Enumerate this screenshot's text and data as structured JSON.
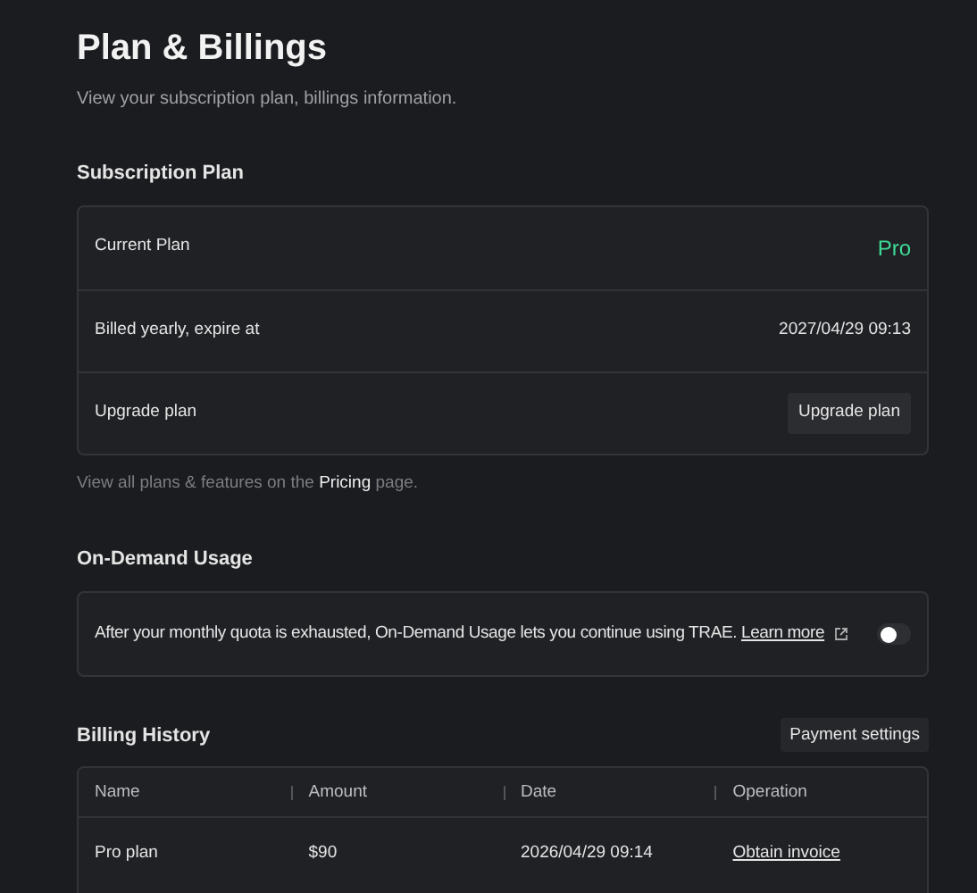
{
  "header": {
    "title": "Plan & Billings",
    "subtitle": "View your subscription plan, billings information."
  },
  "subscription": {
    "heading": "Subscription Plan",
    "rows": [
      {
        "kind": "plan",
        "label": "Current Plan",
        "value": "Pro"
      },
      {
        "kind": "text",
        "label": "Billed yearly, expire at",
        "value": "2027/04/29 09:13"
      },
      {
        "kind": "button",
        "label": "Upgrade plan",
        "value": "Upgrade plan"
      }
    ],
    "note": {
      "before": "View all plans & features on the",
      "link": "Pricing",
      "after": "page."
    }
  },
  "on_demand": {
    "heading": "On-Demand Usage",
    "text": "After your monthly quota is exhausted, On-Demand Usage lets you continue using TRAE.",
    "link": "Learn more",
    "toggle": {
      "on": false
    }
  },
  "billing": {
    "heading": "Billing History",
    "button": "Payment settings",
    "columns": [
      "Name",
      "Amount",
      "Date",
      "Operation"
    ],
    "rows": [
      {
        "cells": [
          "Pro plan",
          "$90",
          "2026/04/29 09:14"
        ],
        "operation": "Obtain invoice"
      }
    ]
  }
}
